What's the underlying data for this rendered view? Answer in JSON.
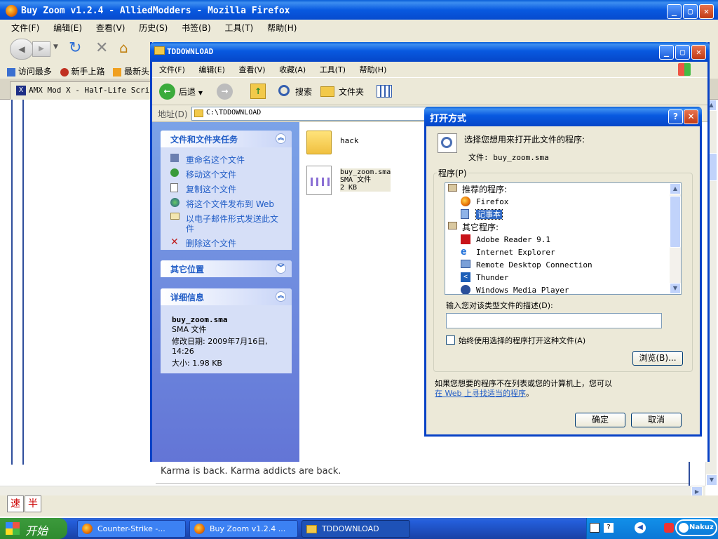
{
  "firefox": {
    "title": "Buy Zoom v1.2.4 - AlliedModders - Mozilla Firefox",
    "menu": [
      "文件(F)",
      "编辑(E)",
      "查看(V)",
      "历史(S)",
      "书签(B)",
      "工具(T)",
      "帮助(H)"
    ],
    "bookmarks": [
      "访问最多",
      "新手上路",
      "最新头"
    ],
    "tab": "AMX Mod X - Half-Life Scripting",
    "page_text": "Karma is back. Karma addicts are back.",
    "status_btn1": "速",
    "status_btn2": "半"
  },
  "explorer": {
    "title": "TDDOWNLOAD",
    "menu": [
      "文件(F)",
      "编辑(E)",
      "查看(V)",
      "收藏(A)",
      "工具(T)",
      "帮助(H)"
    ],
    "toolbar": {
      "back": "后退",
      "search": "搜索",
      "folders": "文件夹"
    },
    "address_label": "地址(D)",
    "address_value": "C:\\TDDOWNLOAD",
    "tasks_title": "文件和文件夹任务",
    "tasks": [
      "重命名这个文件",
      "移动这个文件",
      "复制这个文件",
      "将这个文件发布到 Web",
      "以电子邮件形式发送此文件",
      "删除这个文件"
    ],
    "other_places_title": "其它位置",
    "details_title": "详细信息",
    "details": {
      "name": "buy_zoom.sma",
      "type": "SMA 文件",
      "modified": "修改日期: 2009年7月16日, 14:26",
      "size": "大小: 1.98 KB"
    },
    "files": [
      {
        "name": "hack"
      },
      {
        "name": "buy_zoom.sma",
        "type": "SMA 文件",
        "size": "2 KB"
      }
    ]
  },
  "dialog": {
    "title": "打开方式",
    "prompt": "选择您想用来打开此文件的程序:",
    "file_label": "文件: buy_zoom.sma",
    "programs_label": "程序(P)",
    "recommended_label": "推荐的程序:",
    "recommended": [
      "Firefox",
      "记事本"
    ],
    "other_label": "其它程序:",
    "others": [
      "Adobe Reader 9.1",
      "Internet Explorer",
      "Remote Desktop Connection",
      "Thunder",
      "Windows Media Player"
    ],
    "desc_label": "输入您对该类型文件的描述(D):",
    "desc_value": "",
    "always_label": "始终使用选择的程序打开这种文件(A)",
    "always_checked": false,
    "browse": "浏览(B)...",
    "footer1": "如果您想要的程序不在列表或您的计算机上，您可以",
    "footer_link": "在 Web 上寻找适当的程序",
    "footer_end": "。",
    "ok": "确定",
    "cancel": "取消"
  },
  "taskbar": {
    "start": "开始",
    "items": [
      "Counter-Strike -...",
      "Buy Zoom v1.2.4 ...",
      "TDDOWNLOAD"
    ],
    "active_item": "TDDOWNLOAD",
    "tray_badge": "Nakuz"
  },
  "colors": {
    "xp_blue": "#0a5fd8",
    "panel": "#d6dff7",
    "link": "#215dc6",
    "taskbar": "#245edb",
    "start": "#3c9a3c"
  }
}
